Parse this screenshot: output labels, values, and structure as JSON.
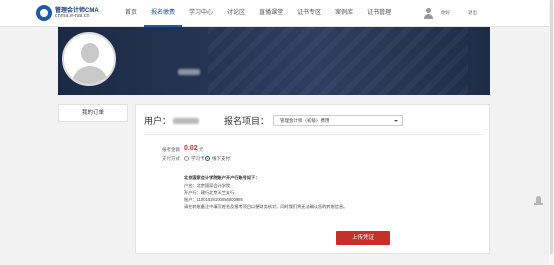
{
  "header": {
    "logo_title": "管理会计师CMA",
    "logo_sub": "cnma.e-nai.cn",
    "nav": [
      {
        "label": "首页",
        "active": false
      },
      {
        "label": "报名缴费",
        "active": true
      },
      {
        "label": "学习中心",
        "active": false
      },
      {
        "label": "讨论区",
        "active": false
      },
      {
        "label": "直播课堂",
        "active": false
      },
      {
        "label": "证书专区",
        "active": false
      },
      {
        "label": "案例库",
        "active": false
      },
      {
        "label": "证书管理",
        "active": false
      }
    ],
    "link_1": "你好",
    "link_2": "退出"
  },
  "sidebar": {
    "my_orders": "我的订单"
  },
  "main": {
    "user_label": "用户：",
    "project_label": "报名项目：",
    "project_value": "管理会计师（初级）费用",
    "fee_label": "报考金额",
    "fee_amount": "0.02",
    "fee_unit": "元",
    "pay_method_label": "支付方式",
    "pay_option_1": "学习卡",
    "pay_option_2": "线下支付",
    "bank_title": "北京国家会计学院账户开户行账号如下：",
    "bank_name": "户名：北京国家会计学院",
    "bank_branch": "开户行：建行北京天竺支行",
    "bank_account": "账户：11001028100056000985",
    "bank_note": "请在转账备注中填写姓名及报考项目以便财务核对，同时我们将无法确认您的转账信息。",
    "upload_button": "上传凭证"
  },
  "colors": {
    "brand": "#1f5aa6",
    "accent_red": "#c23229",
    "banner_dark": "#1b2a44"
  },
  "icons": [
    "logo-icon",
    "user-icon",
    "avatar-placeholder-icon",
    "radio-icon",
    "caret-down-icon",
    "feedback-icon"
  ]
}
